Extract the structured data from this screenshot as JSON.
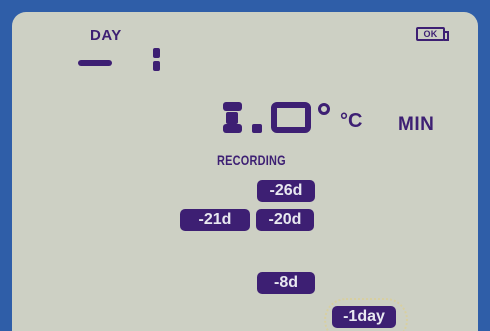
{
  "lcd": {
    "day_label": "DAY",
    "battery_status": "OK",
    "unit": "°C",
    "mode_label": "MIN",
    "status_label": "RECORDING",
    "history_badges": [
      "-26d",
      "-21d",
      "-20d",
      "-8d",
      "-1day"
    ],
    "selected_badge": "-1day",
    "colors": {
      "frame": "#2f5ea8",
      "screen": "#cdd0c4",
      "ink": "#3d1f73"
    },
    "icons": [
      "battery-icon",
      "seven-segment-digits"
    ]
  }
}
